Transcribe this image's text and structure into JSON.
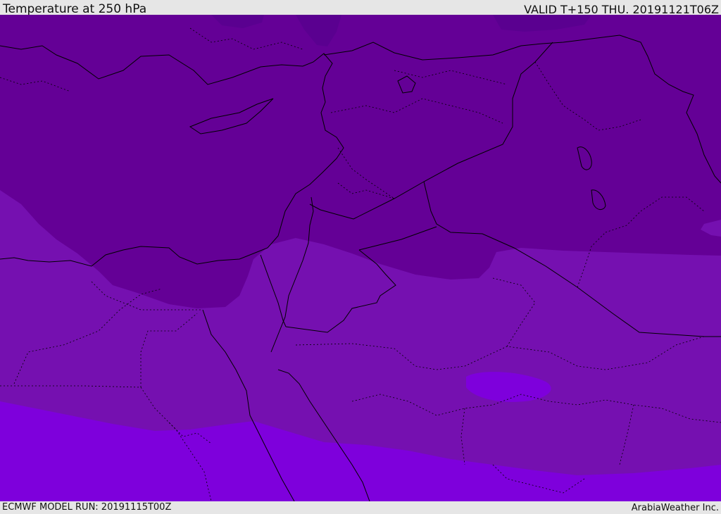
{
  "header": {
    "title": "Temperature at 250 hPa",
    "valid_time": "VALID T+150 THU. 20191121T06Z"
  },
  "footer": {
    "model_run": "ECMWF MODEL RUN: 20191115T00Z",
    "credit": "ArabiaWeather Inc."
  },
  "colors": {
    "band_darkest": "#5a0090",
    "band_dark": "#640096",
    "band_mid": "#7510b0",
    "band_light": "#7e00dc",
    "border_line": "#000000",
    "frame": "#e6e6e6"
  }
}
